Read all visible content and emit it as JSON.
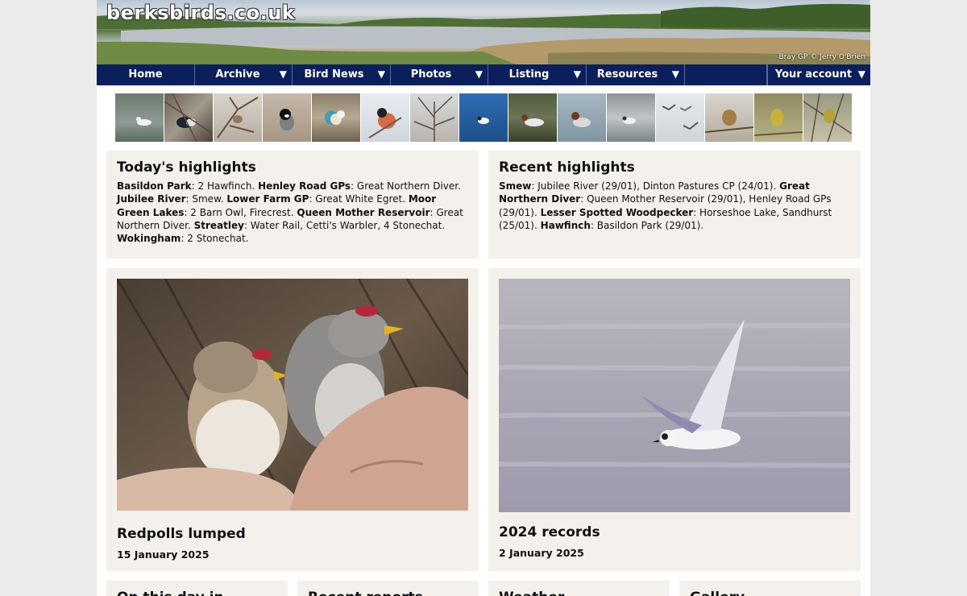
{
  "site": {
    "logo": "berksbirds.co.uk",
    "banner_credit": "Bray GP © Jerry O'Brien"
  },
  "nav": {
    "items": [
      {
        "label": "Home",
        "dropdown": false
      },
      {
        "label": "Archive",
        "dropdown": true
      },
      {
        "label": "Bird News",
        "dropdown": true
      },
      {
        "label": "Photos",
        "dropdown": true
      },
      {
        "label": "Listing",
        "dropdown": true
      },
      {
        "label": "Resources",
        "dropdown": true
      },
      {
        "label": "",
        "dropdown": false
      },
      {
        "label": "Your account",
        "dropdown": true
      }
    ],
    "arrow": "▼"
  },
  "thumbnails": [
    {
      "icon": "smew-on-water"
    },
    {
      "icon": "bird-in-branches"
    },
    {
      "icon": "bird-in-twigs"
    },
    {
      "icon": "coal-tit"
    },
    {
      "icon": "blue-tit"
    },
    {
      "icon": "bullfinch"
    },
    {
      "icon": "bird-in-bare-tree"
    },
    {
      "icon": "duck-on-blue-water"
    },
    {
      "icon": "goosander"
    },
    {
      "icon": "duck-on-lake"
    },
    {
      "icon": "grebe"
    },
    {
      "icon": "gulls-in-flight"
    },
    {
      "icon": "bunting"
    },
    {
      "icon": "yellowhammer"
    },
    {
      "icon": "yellowhammer-in-tree"
    }
  ],
  "todays_highlights": {
    "title": "Today's highlights",
    "entries": [
      {
        "site": "Basildon Park",
        "text": ": 2 Hawfinch. "
      },
      {
        "site": "Henley Road GPs",
        "text": ": Great Northern Diver. "
      },
      {
        "site": "Jubilee River",
        "text": ": Smew. "
      },
      {
        "site": "Lower Farm GP",
        "text": ": Great White Egret. "
      },
      {
        "site": "Moor Green Lakes",
        "text": ": 2 Barn Owl, Firecrest. "
      },
      {
        "site": "Queen Mother Reservoir",
        "text": ": Great Northern Diver. "
      },
      {
        "site": "Streatley",
        "text": ": Water Rail, Cetti's Warbler, 4 Stonechat. "
      },
      {
        "site": "Wokingham",
        "text": ": 2 Stonechat."
      }
    ]
  },
  "recent_highlights": {
    "title": "Recent highlights",
    "entries": [
      {
        "species": "Smew",
        "text": ": Jubilee River (29/01), Dinton Pastures CP (24/01). "
      },
      {
        "species": "Great Northern Diver",
        "text": ": Queen Mother Reservoir (29/01), Henley Road GPs (29/01). "
      },
      {
        "species": "Lesser Spotted Woodpecker",
        "text": ": Horseshoe Lake, Sandhurst (25/01). "
      },
      {
        "species": "Hawfinch",
        "text": ": Basildon Park (29/01)."
      }
    ]
  },
  "stories": [
    {
      "title": "Redpolls lumped",
      "date": "15 January 2025",
      "image": "redpolls-in-hand"
    },
    {
      "title": "2024 records",
      "date": "2 January 2025",
      "image": "tern-in-flight"
    }
  ],
  "bottom_panels": [
    {
      "title": "On this day in"
    },
    {
      "title": "Recent reports"
    },
    {
      "title": "Weather"
    },
    {
      "title": "Gallery"
    }
  ],
  "colors": {
    "nav_bg": "#0b1f5c",
    "panel_bg": "#f4f1ec",
    "page_bg": "#ebebeb"
  }
}
